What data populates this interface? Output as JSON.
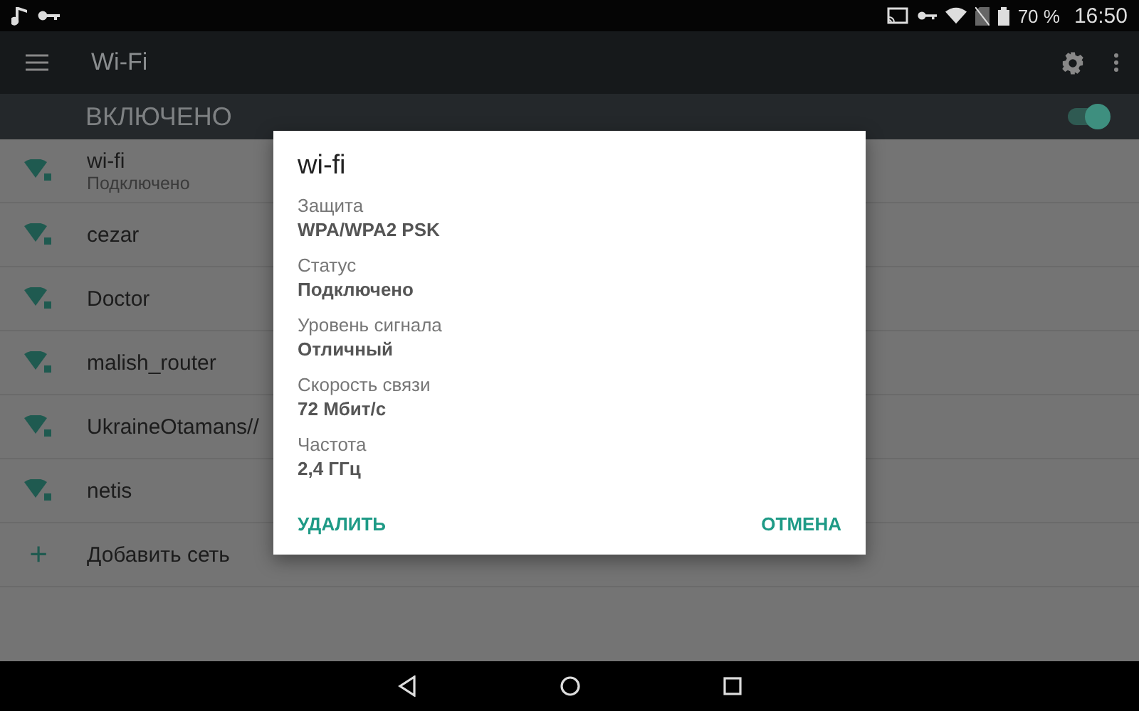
{
  "status_bar": {
    "battery": "70 %",
    "time": "16:50"
  },
  "toolbar": {
    "title": "Wi-Fi"
  },
  "wifi_switch": {
    "label": "ВКЛЮЧЕНО",
    "on": true
  },
  "networks": [
    {
      "name": "wi-fi",
      "status": "Подключено"
    },
    {
      "name": "cezar"
    },
    {
      "name": "Doctor"
    },
    {
      "name": "malish_router"
    },
    {
      "name": "UkraineOtamans//"
    },
    {
      "name": "netis"
    }
  ],
  "add_network": {
    "icon": "+",
    "label": "Добавить сеть"
  },
  "dialog": {
    "title": "wi-fi",
    "fields": [
      {
        "label": "Защита",
        "value": "WPA/WPA2 PSK"
      },
      {
        "label": "Статус",
        "value": "Подключено"
      },
      {
        "label": "Уровень сигнала",
        "value": "Отличный"
      },
      {
        "label": "Скорость связи",
        "value": "72 Мбит/с"
      },
      {
        "label": "Частота",
        "value": "2,4 ГГц"
      }
    ],
    "buttons": [
      "УДАЛИТЬ",
      "ОТМЕНА"
    ]
  }
}
